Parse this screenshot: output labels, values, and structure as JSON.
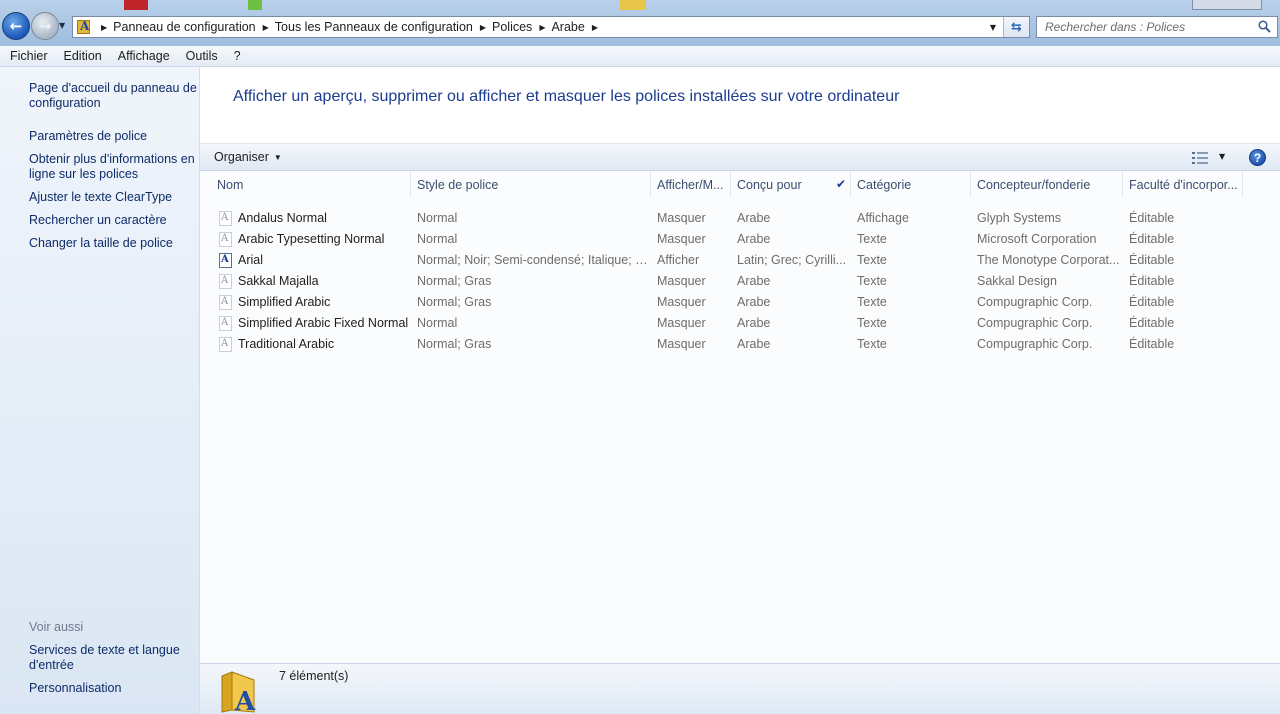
{
  "breadcrumb": {
    "items": [
      "Panneau de configuration",
      "Tous les Panneaux de configuration",
      "Polices",
      "Arabe"
    ]
  },
  "search": {
    "placeholder": "Rechercher dans : Polices"
  },
  "menu": {
    "items": [
      "Fichier",
      "Edition",
      "Affichage",
      "Outils",
      "?"
    ]
  },
  "sidebar": {
    "links": [
      "Page d'accueil du panneau de configuration",
      "Paramètres de police",
      "Obtenir plus d'informations en ligne sur les polices",
      "Ajuster le texte ClearType",
      "Rechercher un caractère",
      "Changer la taille de police"
    ],
    "see_also_heading": "Voir aussi",
    "see_also": [
      "Services de texte et langue d'entrée",
      "Personnalisation"
    ]
  },
  "main": {
    "headline": "Afficher un aperçu, supprimer ou afficher et masquer les polices installées sur votre ordinateur",
    "organize_label": "Organiser",
    "help_label": "?"
  },
  "table": {
    "columns": [
      "Nom",
      "Style de police",
      "Afficher/M...",
      "Conçu pour",
      "Catégorie",
      "Concepteur/fonderie",
      "Faculté d'incorpor..."
    ],
    "rows": [
      {
        "name": "Andalus Normal",
        "style": "Normal",
        "show": "Masquer",
        "designed_for": "Arabe",
        "category": "Affichage",
        "designer": "Glyph Systems",
        "embeddability": "Éditable"
      },
      {
        "name": "Arabic Typesetting Normal",
        "style": "Normal",
        "show": "Masquer",
        "designed_for": "Arabe",
        "category": "Texte",
        "designer": "Microsoft Corporation",
        "embeddability": "Éditable"
      },
      {
        "name": "Arial",
        "style": "Normal; Noir; Semi-condensé; Italique; G...",
        "show": "Afficher",
        "designed_for": "Latin; Grec; Cyrilli...",
        "category": "Texte",
        "designer": "The Monotype Corporat...",
        "embeddability": "Éditable"
      },
      {
        "name": "Sakkal Majalla",
        "style": "Normal; Gras",
        "show": "Masquer",
        "designed_for": "Arabe",
        "category": "Texte",
        "designer": "Sakkal Design",
        "embeddability": "Éditable"
      },
      {
        "name": "Simplified Arabic",
        "style": "Normal; Gras",
        "show": "Masquer",
        "designed_for": "Arabe",
        "category": "Texte",
        "designer": "Compugraphic Corp.",
        "embeddability": "Éditable"
      },
      {
        "name": "Simplified Arabic Fixed Normal",
        "style": "Normal",
        "show": "Masquer",
        "designed_for": "Arabe",
        "category": "Texte",
        "designer": "Compugraphic Corp.",
        "embeddability": "Éditable"
      },
      {
        "name": "Traditional Arabic",
        "style": "Normal; Gras",
        "show": "Masquer",
        "designed_for": "Arabe",
        "category": "Texte",
        "designer": "Compugraphic Corp.",
        "embeddability": "Éditable"
      }
    ]
  },
  "status": {
    "count": "7 élément(s)"
  }
}
